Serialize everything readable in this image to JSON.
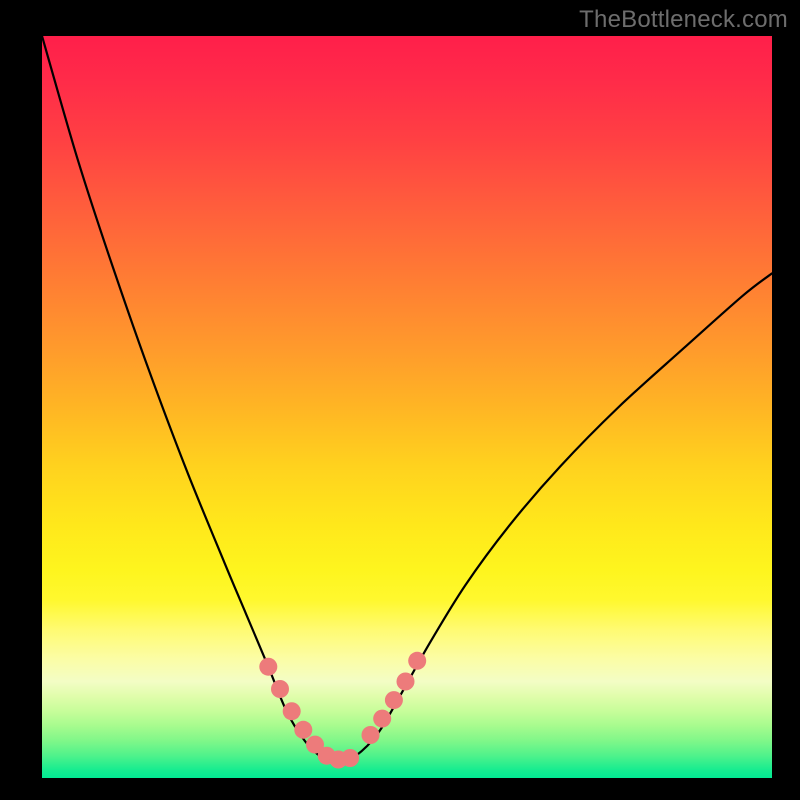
{
  "watermark": "TheBottleneck.com",
  "chart_data": {
    "type": "line",
    "title": "",
    "xlabel": "",
    "ylabel": "",
    "xlim": [
      0,
      100
    ],
    "ylim": [
      0,
      100
    ],
    "grid": false,
    "annotations": [],
    "series": [
      {
        "name": "bottleneck-curve",
        "x": [
          0,
          5,
          10,
          15,
          20,
          25,
          28,
          31,
          33.5,
          36,
          38,
          39.5,
          41,
          43,
          46,
          49,
          53,
          58,
          64,
          71,
          79,
          88,
          96,
          100
        ],
        "y": [
          100,
          83,
          68,
          54,
          41,
          29,
          22,
          15,
          9,
          5,
          3,
          2.3,
          2.3,
          3,
          6,
          11,
          18,
          26,
          34,
          42,
          50,
          58,
          65,
          68
        ]
      },
      {
        "name": "highlight-dots",
        "x": [
          31,
          32.6,
          34.2,
          35.8,
          37.4,
          39,
          40.6,
          42.2,
          45,
          46.6,
          48.2,
          49.8,
          51.4
        ],
        "y": [
          15,
          12,
          9,
          6.5,
          4.5,
          3,
          2.5,
          2.7,
          5.8,
          8,
          10.5,
          13,
          15.8
        ]
      }
    ],
    "gradient_stops": [
      {
        "pos": 0,
        "color": "#ff1f4a"
      },
      {
        "pos": 50,
        "color": "#ffb524"
      },
      {
        "pos": 76,
        "color": "#fff82e"
      },
      {
        "pos": 87,
        "color": "#f3fdc5"
      },
      {
        "pos": 100,
        "color": "#02e993"
      }
    ],
    "highlight_color": "#ed7b7b",
    "curve_color": "#000000"
  }
}
